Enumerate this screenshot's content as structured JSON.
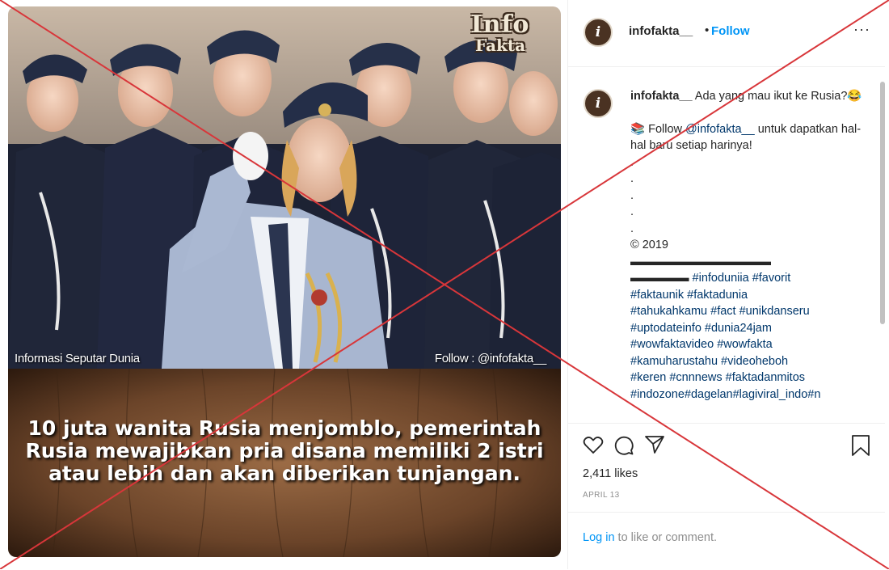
{
  "post": {
    "image": {
      "logo_line1": "Info",
      "logo_line2": "Fakta",
      "caption_left": "Informasi Seputar Dunia",
      "caption_right": "Follow : @infofakta__",
      "headline_lines": [
        "10 juta wanita Rusia menjomblo, pemerintah",
        "Rusia mewajibkan pria disana memiliki 2 istri",
        "atau lebih dan akan diberikan tunjangan."
      ]
    },
    "header": {
      "username": "infofakta__",
      "separator": "•",
      "follow_label": "Follow",
      "more_label": "···"
    },
    "caption": {
      "username": "infofakta__",
      "text1": "Ada yang mau ikut ke Rusia?😂",
      "follow_prefix": "📚 Follow",
      "mention": "@infofakta__",
      "follow_suffix": "untuk dapatkan hal-hal baru setiap harinya!",
      "dots": [
        ".",
        ".",
        ".",
        ".",
        "."
      ],
      "copyright": "© 2019",
      "dash_line1": "▬▬▬▬▬▬▬▬▬▬▬▬",
      "dash_line2": "▬▬▬▬▬",
      "hashtags_line1": "#infoduniia #favorit",
      "hashtags": [
        "#faktaunik #faktadunia",
        "#tahukahkamu #fact #unikdanseru",
        "#uptodateinfo #dunia24jam",
        "#wowfaktavideo #wowfakta",
        "#kamuharustahu #videoheboh",
        "#keren #cnnnews #faktadanmitos",
        "#indozone#dagelan#lagiviral_indo#n"
      ]
    },
    "actions": {
      "likes": "2,411 likes",
      "date": "APRIL 13"
    },
    "login": {
      "link": "Log in",
      "suffix": " to like or comment."
    },
    "colors": {
      "accent": "#0095f6",
      "cross": "#d8363a",
      "avatar": "#4a3222"
    }
  }
}
